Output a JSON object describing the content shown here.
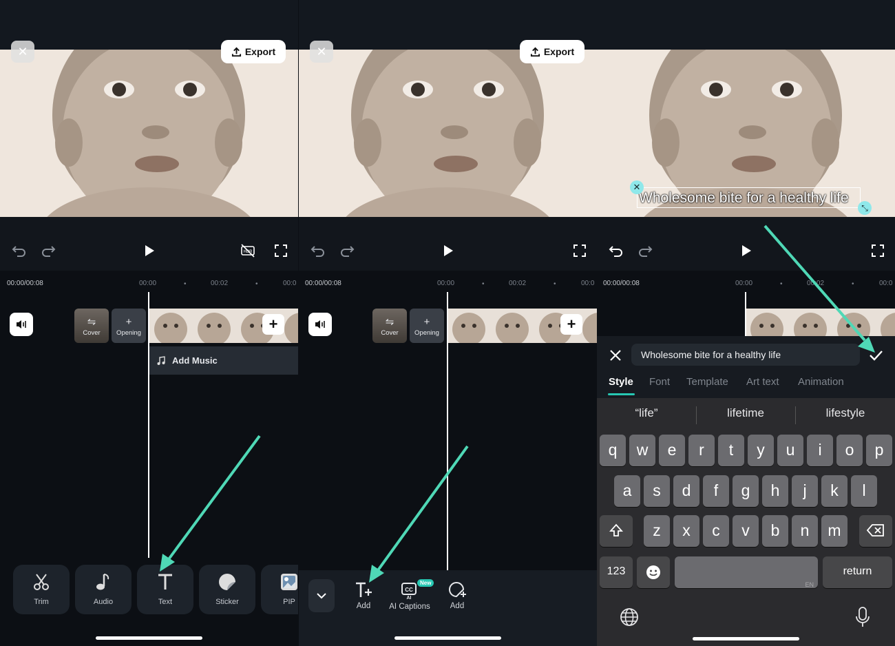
{
  "panels": [
    {
      "close_icon": "close-icon",
      "export_label": "Export",
      "timecode": "00:00/00:08",
      "ticks": [
        "00:00",
        "00:02",
        "00:0"
      ],
      "cover_label": "Cover",
      "opening_label": "Opening",
      "add_music_label": "Add Music",
      "toolbar": [
        {
          "label": "Trim",
          "icon": "scissors-icon"
        },
        {
          "label": "Audio",
          "icon": "music-note-icon"
        },
        {
          "label": "Text",
          "icon": "text-icon"
        },
        {
          "label": "Sticker",
          "icon": "sticker-icon"
        },
        {
          "label": "PIP",
          "icon": "pip-icon"
        }
      ]
    },
    {
      "close_icon": "close-icon",
      "export_label": "Export",
      "timecode": "00:00/00:08",
      "ticks": [
        "00:00",
        "00:02",
        "00:0"
      ],
      "cover_label": "Cover",
      "opening_label": "Opening",
      "text_menu": [
        {
          "label": "Add",
          "icon": "add-text-icon"
        },
        {
          "label": "AI Captions",
          "icon": "ai-captions-icon",
          "badge": "New"
        },
        {
          "label": "Add",
          "icon": "add-sticker-icon"
        }
      ]
    },
    {
      "overlay_text": "Wholesome bite for a healthy life",
      "timecode": "00:00/00:08",
      "ticks": [
        "00:00",
        "00:02",
        "00:0"
      ],
      "editor": {
        "input_value": "Wholesome bite for a healthy life",
        "tabs": [
          "Style",
          "Font",
          "Template",
          "Art text",
          "Animation"
        ],
        "active_tab": "Style"
      },
      "keyboard": {
        "suggestions": [
          "“life”",
          "lifetime",
          "lifestyle"
        ],
        "row1": [
          "q",
          "w",
          "e",
          "r",
          "t",
          "y",
          "u",
          "i",
          "o",
          "p"
        ],
        "row2": [
          "a",
          "s",
          "d",
          "f",
          "g",
          "h",
          "j",
          "k",
          "l"
        ],
        "row3": [
          "z",
          "x",
          "c",
          "v",
          "b",
          "n",
          "m"
        ],
        "numbers_label": "123",
        "return_label": "return",
        "space_hint": "EN"
      }
    }
  ],
  "colors": {
    "accent": "#27c8b3",
    "annotation_arrow": "#4fd8b6",
    "background": "#0c0f14"
  }
}
